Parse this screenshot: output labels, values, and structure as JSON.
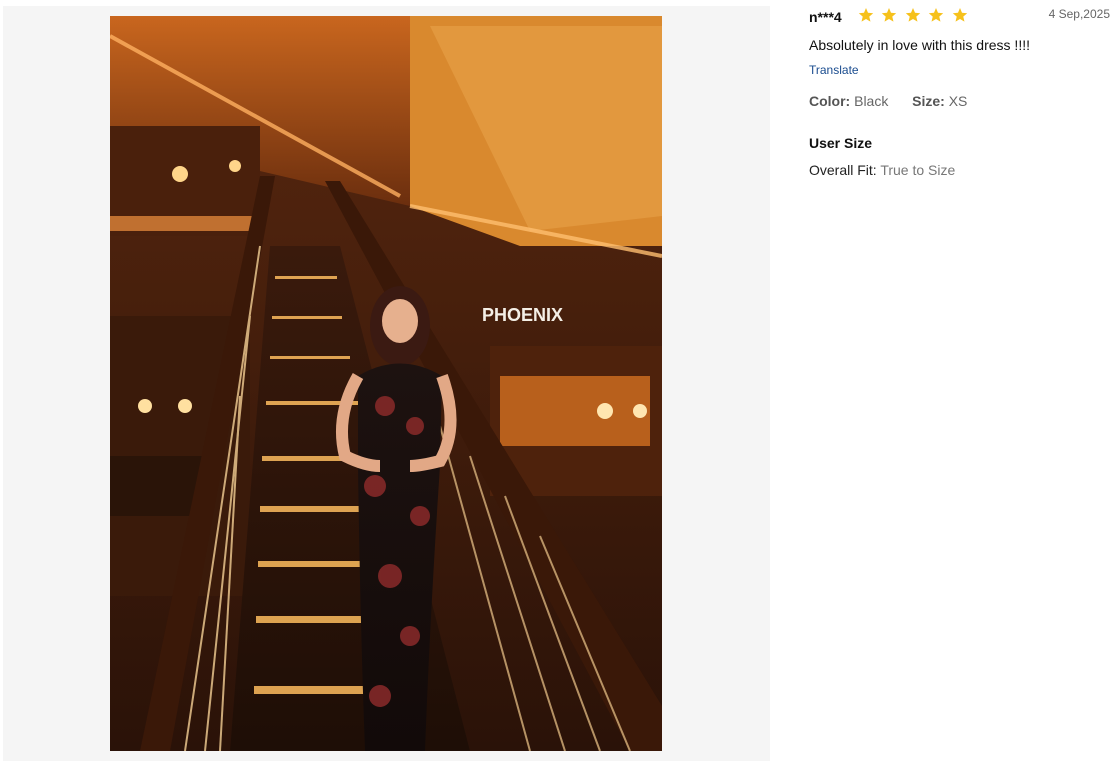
{
  "photo": {
    "sign_text": "PHOENIX",
    "description_icon": "review-photo"
  },
  "review": {
    "username": "n***4",
    "rating": 5,
    "rating_max": 5,
    "star_color": "#f6c11b",
    "date": "4 Sep,2025",
    "text": "Absolutely in love with this dress !!!!",
    "translate_label": "Translate",
    "color_label": "Color:",
    "color_value": "Black",
    "size_label": "Size:",
    "size_value": "XS",
    "user_size_title": "User Size",
    "fit_label": "Overall Fit:",
    "fit_value": "True to Size"
  }
}
